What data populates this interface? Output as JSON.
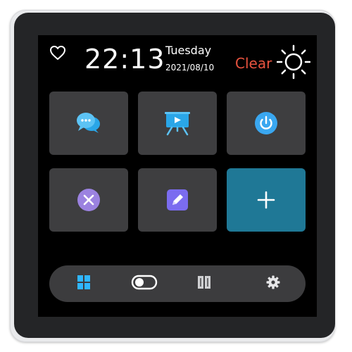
{
  "header": {
    "time": "22:13",
    "day": "Tuesday",
    "date": "2021/08/10",
    "weather": "Clear"
  },
  "apps": [
    {
      "icon": "chat-bubbles-icon"
    },
    {
      "icon": "presentation-board-icon"
    },
    {
      "icon": "power-icon"
    },
    {
      "icon": "close-circle-icon"
    },
    {
      "icon": "edit-note-icon"
    },
    {
      "icon": "plus-icon"
    }
  ],
  "dock": [
    {
      "icon": "windows-grid-icon",
      "active": true
    },
    {
      "icon": "toggle-switch-icon"
    },
    {
      "icon": "book-icon"
    },
    {
      "icon": "gear-icon"
    }
  ],
  "colors": {
    "screen_bg": "#000000",
    "tile_bg": "#3e3e40",
    "add_tile_bg": "#1f7896",
    "weather_text": "#e8533f",
    "dock_bg": "#3c3c3e"
  }
}
